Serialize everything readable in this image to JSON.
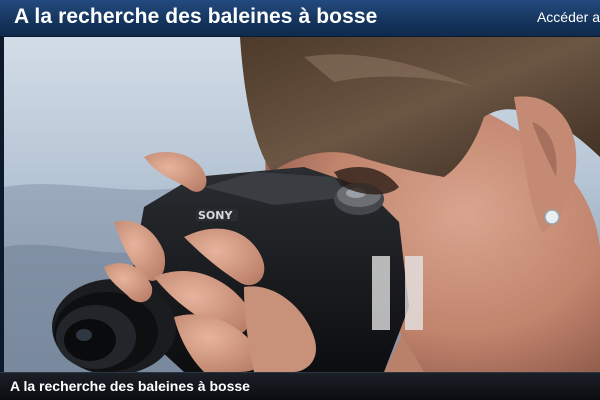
{
  "header": {
    "title": "A la recherche des baleines à bosse",
    "access_link": "Accéder a"
  },
  "video": {
    "state": "paused",
    "caption": "A la recherche des baleines à bosse",
    "pause_icon": "pause-icon"
  },
  "colors": {
    "header_bar": "#1b3f6c",
    "caption_bar": "#111419",
    "overlay_icon": "#e6e6e6"
  }
}
